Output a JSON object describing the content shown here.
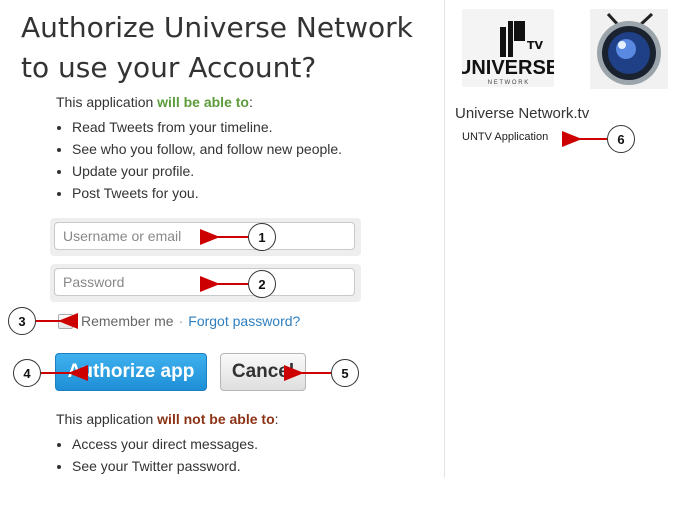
{
  "page_title": "Authorize Universe Network to use your Account?",
  "permissions_allowed": {
    "prefix": "This application ",
    "emphasis": "will be able to",
    "suffix": ":",
    "items": [
      "Read Tweets from your timeline.",
      "See who you follow, and follow new people.",
      "Update your profile.",
      "Post Tweets for you."
    ]
  },
  "form": {
    "username_placeholder": "Username or email",
    "password_placeholder": "Password",
    "remember_label": "Remember me",
    "separator": "·",
    "forgot_label": "Forgot password?",
    "authorize_label": "Authorize app",
    "cancel_label": "Cancel"
  },
  "permissions_denied": {
    "prefix": "This application ",
    "emphasis": "will not be able to",
    "suffix": ":",
    "items": [
      "Access your direct messages.",
      "See your Twitter password."
    ]
  },
  "app": {
    "logo_main": "UN",
    "logo_tv": "TV",
    "logo_word": "UNIVERSE",
    "logo_sub": "N E T W O R K",
    "name": "Universe Network.tv",
    "description": "UNTV Application"
  },
  "callouts": [
    "1",
    "2",
    "3",
    "4",
    "5",
    "6"
  ],
  "colors": {
    "allowed": "#5c9c3b",
    "denied": "#8c3316",
    "link": "#2f7fbf",
    "primary_button": "#2a9de3",
    "arrow": "#cc0000"
  }
}
